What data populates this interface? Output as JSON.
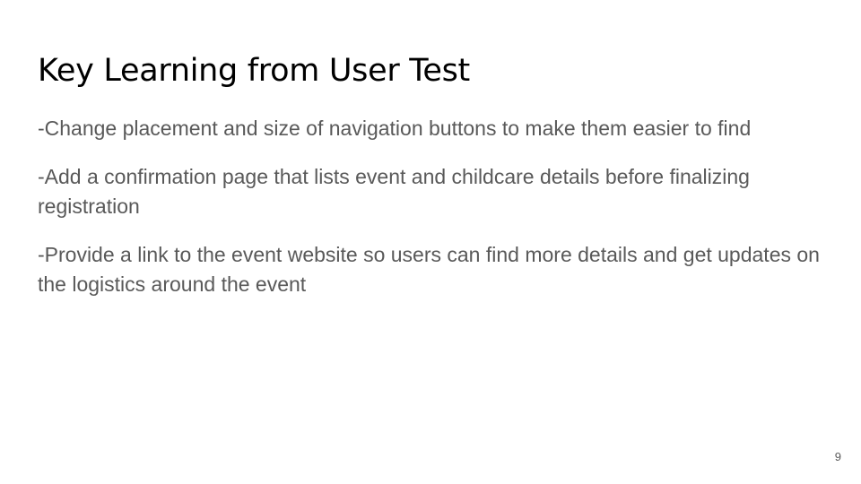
{
  "slide": {
    "title": "Key Learning from User Test",
    "bullets": [
      "-Change placement and size of navigation buttons to make them easier to find",
      "-Add a confirmation page that lists event and childcare details before finalizing registration",
      "-Provide a link to the event website so users can find more details and get updates on the logistics around the event"
    ],
    "page_number": "9"
  },
  "colors": {
    "background": "#ffffff",
    "title": "#000000",
    "body_text": "#595959"
  }
}
